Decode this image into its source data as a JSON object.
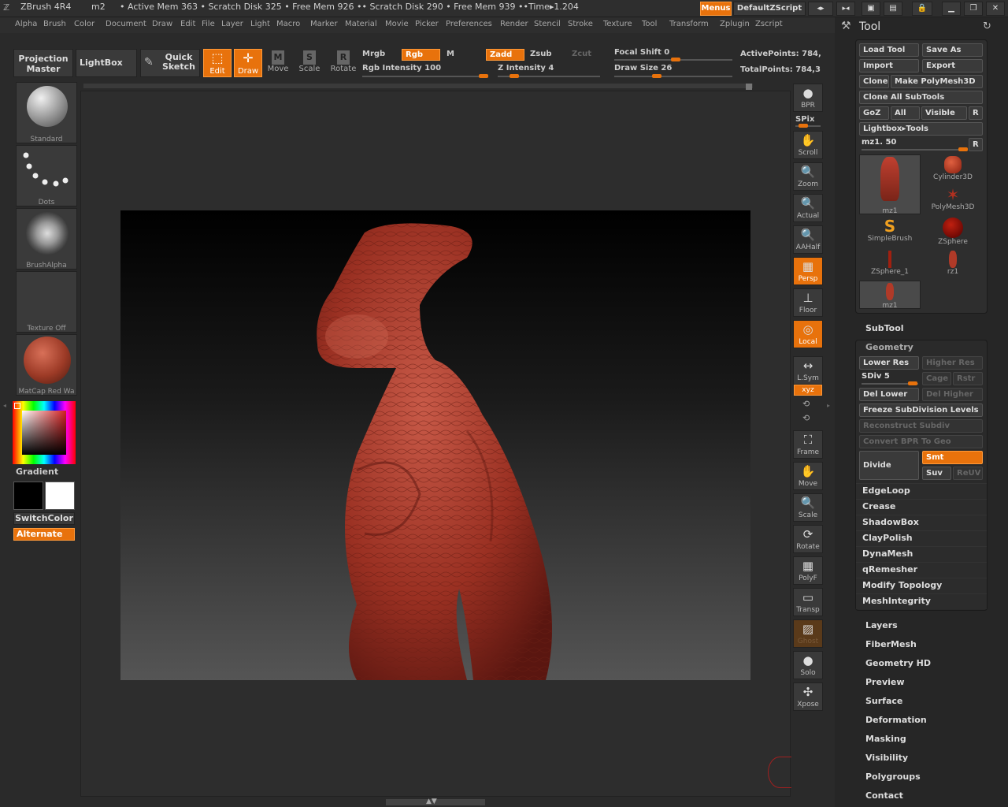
{
  "titlebar": {
    "app": "ZBrush 4R4",
    "doc": "m2",
    "status": "• Active Mem 363 • Scratch Disk 325 • Free Mem 926 •• Scratch Disk 290 • Free Mem 939 ••Time▸1.204",
    "menus_btn": "Menus",
    "script_btn": "DefaultZScript"
  },
  "menubar": [
    "Alpha",
    "Brush",
    "Color",
    "Document",
    "Draw",
    "Edit",
    "File",
    "Layer",
    "Light",
    "Macro",
    "Marker",
    "Material",
    "Movie",
    "Picker",
    "Preferences",
    "Render",
    "Stencil",
    "Stroke",
    "Texture",
    "Tool",
    "Transform",
    "Zplugin",
    "Zscript"
  ],
  "toolbar": {
    "projection_master": "Projection Master",
    "lightbox": "LightBox",
    "quick_sketch": "Quick Sketch",
    "edit": "Edit",
    "draw": "Draw",
    "move": "Move",
    "scale": "Scale",
    "rotate": "Rotate",
    "mrgb": "Mrgb",
    "rgb": "Rgb",
    "m": "M",
    "zadd": "Zadd",
    "zsub": "Zsub",
    "zcut": "Zcut",
    "rgb_intensity": "Rgb Intensity 100",
    "z_intensity": "Z Intensity 4",
    "focal_shift": "Focal Shift 0",
    "draw_size": "Draw Size 26",
    "active_points": "ActivePoints: 784,",
    "total_points": "TotalPoints: 784,3",
    "rgb_intensity_level": 1.0,
    "z_intensity_level": 0.04,
    "focal_shift_level": 0.5,
    "draw_size_level": 0.26
  },
  "leftshelf": {
    "brush": "Standard",
    "stroke": "Dots",
    "alpha": "BrushAlpha",
    "texture": "Texture Off",
    "material": "MatCap Red Wa",
    "gradient": "Gradient",
    "switchcolor": "SwitchColor",
    "alternate": "Alternate"
  },
  "rightshelf": [
    {
      "label": "BPR",
      "icon": "render-sphere-icon",
      "on": false
    },
    {
      "label": "SPix",
      "icon": "",
      "on": false
    },
    {
      "label": "Scroll",
      "icon": "scroll-hand-icon",
      "on": false
    },
    {
      "label": "Zoom",
      "icon": "zoom-icon",
      "on": false
    },
    {
      "label": "Actual",
      "icon": "actual-size-icon",
      "on": false
    },
    {
      "label": "AAHalf",
      "icon": "aa-half-icon",
      "on": false
    },
    {
      "label": "Persp",
      "icon": "perspective-icon",
      "on": true
    },
    {
      "label": "Floor",
      "icon": "floor-icon",
      "on": false
    },
    {
      "label": "Local",
      "icon": "local-icon",
      "on": true
    },
    {
      "label": "L.Sym",
      "icon": "local-symmetry-icon",
      "on": false
    },
    {
      "label": "xyz",
      "icon": "",
      "on": true
    },
    {
      "label": "Frame",
      "icon": "frame-icon",
      "on": false
    },
    {
      "label": "Move",
      "icon": "move-hand-icon",
      "on": false
    },
    {
      "label": "Scale",
      "icon": "scale-icon",
      "on": false
    },
    {
      "label": "Rotate",
      "icon": "rotate-icon",
      "on": false
    },
    {
      "label": "PolyF",
      "icon": "polyframe-icon",
      "on": false
    },
    {
      "label": "Transp",
      "icon": "transparency-icon",
      "on": false
    },
    {
      "label": "Ghost",
      "icon": "ghost-icon",
      "on": false
    },
    {
      "label": "Solo",
      "icon": "solo-icon",
      "on": false
    },
    {
      "label": "Xpose",
      "icon": "xpose-icon",
      "on": false
    }
  ],
  "toolpanel": {
    "title": "Tool",
    "load_tool": "Load Tool",
    "save_as": "Save As",
    "import": "Import",
    "export": "Export",
    "clone": "Clone",
    "make_polymesh": "Make PolyMesh3D",
    "clone_all": "Clone All SubTools",
    "goz": "GoZ",
    "all": "All",
    "visible": "Visible",
    "r": "R",
    "lightbox_tools": "Lightbox▸Tools",
    "mz_slider": "mz1. 50",
    "mz_level": 0.98,
    "tools": [
      {
        "name": "mz1",
        "kind": "figure"
      },
      {
        "name": "Cylinder3D",
        "kind": "cylinder"
      },
      {
        "name": "PolyMesh3D",
        "kind": "star"
      },
      {
        "name": "SimpleBrush",
        "kind": "s"
      },
      {
        "name": "ZSphere",
        "kind": "sphere"
      },
      {
        "name": "ZSphere_1",
        "kind": "stick"
      },
      {
        "name": "rz1",
        "kind": "figure-small"
      },
      {
        "name": "mz1",
        "kind": "figure-small"
      }
    ],
    "subtool": "SubTool",
    "geometry": "Geometry",
    "lower_res": "Lower Res",
    "higher_res": "Higher Res",
    "sdiv": "SDiv 5",
    "sdiv_level": 0.9,
    "cage": "Cage",
    "rstr": "Rstr",
    "del_lower": "Del Lower",
    "del_higher": "Del Higher",
    "freeze": "Freeze SubDivision Levels",
    "reconstruct": "Reconstruct Subdiv",
    "convert_bpr": "Convert BPR To Geo",
    "divide": "Divide",
    "smt": "Smt",
    "suv": "Suv",
    "reuv": "ReUV",
    "geo_items": [
      "EdgeLoop",
      "Crease",
      "ShadowBox",
      "ClayPolish",
      "DynaMesh",
      "qRemesher",
      "Modify Topology",
      "MeshIntegrity"
    ],
    "sections": [
      "Layers",
      "FiberMesh",
      "Geometry HD",
      "Preview",
      "Surface",
      "Deformation",
      "Masking",
      "Visibility",
      "Polygroups",
      "Contact"
    ]
  }
}
